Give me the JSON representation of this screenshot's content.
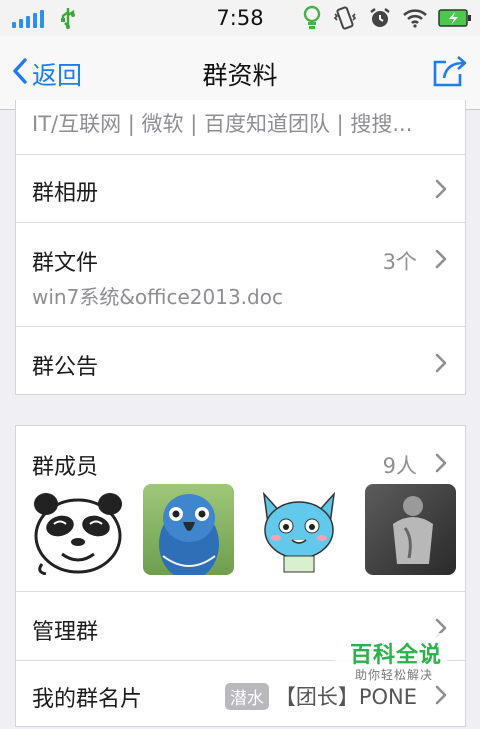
{
  "status_bar": {
    "time": "7:58",
    "icons": [
      "signal-bars-icon",
      "usb-icon",
      "lightbulb-icon",
      "vibrate-icon",
      "alarm-icon",
      "wifi-icon",
      "battery-charging-icon"
    ]
  },
  "nav": {
    "back_label": "返回",
    "title": "群资料",
    "share_icon": "share-icon"
  },
  "top_card": {
    "category_text": "IT/互联网 | 微软 | 百度知道团队 | 搜搜...",
    "album_label": "群相册",
    "files_label": "群文件",
    "files_count": "3个",
    "files_sub": "win7系统&office2013.doc",
    "notice_label": "群公告"
  },
  "members_card": {
    "members_label": "群成员",
    "members_count": "9人",
    "avatars": [
      "panda-avatar",
      "blue-parrot-avatar",
      "blue-cat-avatar",
      "grayscale-person-avatar"
    ],
    "manage_label": "管理群",
    "my_card_label": "我的群名片",
    "my_card_tag": "潜水",
    "my_card_value": "【团长】PONE"
  },
  "watermark": {
    "title": "百科全说",
    "subtitle": "助你轻松解决"
  },
  "colors": {
    "accent": "#1e7cf0",
    "background": "#efeff4",
    "watermark_green": "#27b24a"
  }
}
